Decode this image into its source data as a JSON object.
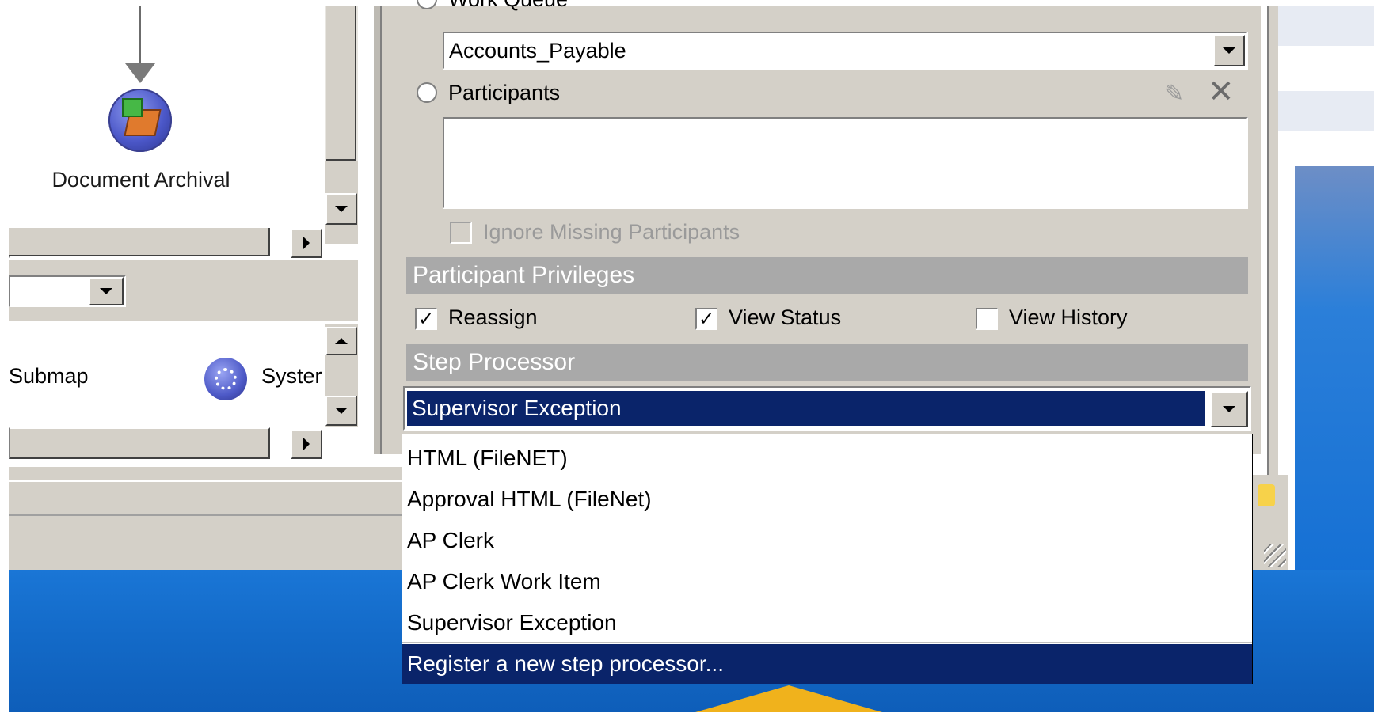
{
  "canvas": {
    "document_archival_label": "Document Archival",
    "submap_label": "Submap",
    "system_label": "Syster"
  },
  "properties": {
    "work_queue_label": "Work Queue",
    "work_queue_value": "Accounts_Payable",
    "participants_label": "Participants",
    "ignore_missing_label": "Ignore Missing Participants",
    "participant_privileges_header": "Participant Privileges",
    "privileges": {
      "reassign": {
        "label": "Reassign",
        "checked": true
      },
      "view_status": {
        "label": "View Status",
        "checked": true
      },
      "view_history": {
        "label": "View History",
        "checked": false
      }
    },
    "step_processor_header": "Step Processor",
    "step_processor_value": "Supervisor Exception",
    "step_processor_options": [
      "HTML (FileNET)",
      "Approval HTML (FileNet)",
      "AP Clerk",
      "AP Clerk Work Item",
      "Supervisor Exception"
    ],
    "register_option": "Register a new step processor..."
  },
  "colors": {
    "selection": "#0a246a",
    "section_bar": "#a9a9a9",
    "dialog_gray": "#d4d0c8",
    "highlight_arrow": "#f0b21c"
  },
  "icons": {
    "edit": "pencil-icon",
    "delete": "close-icon",
    "dropdown": "chevron-down-icon"
  }
}
